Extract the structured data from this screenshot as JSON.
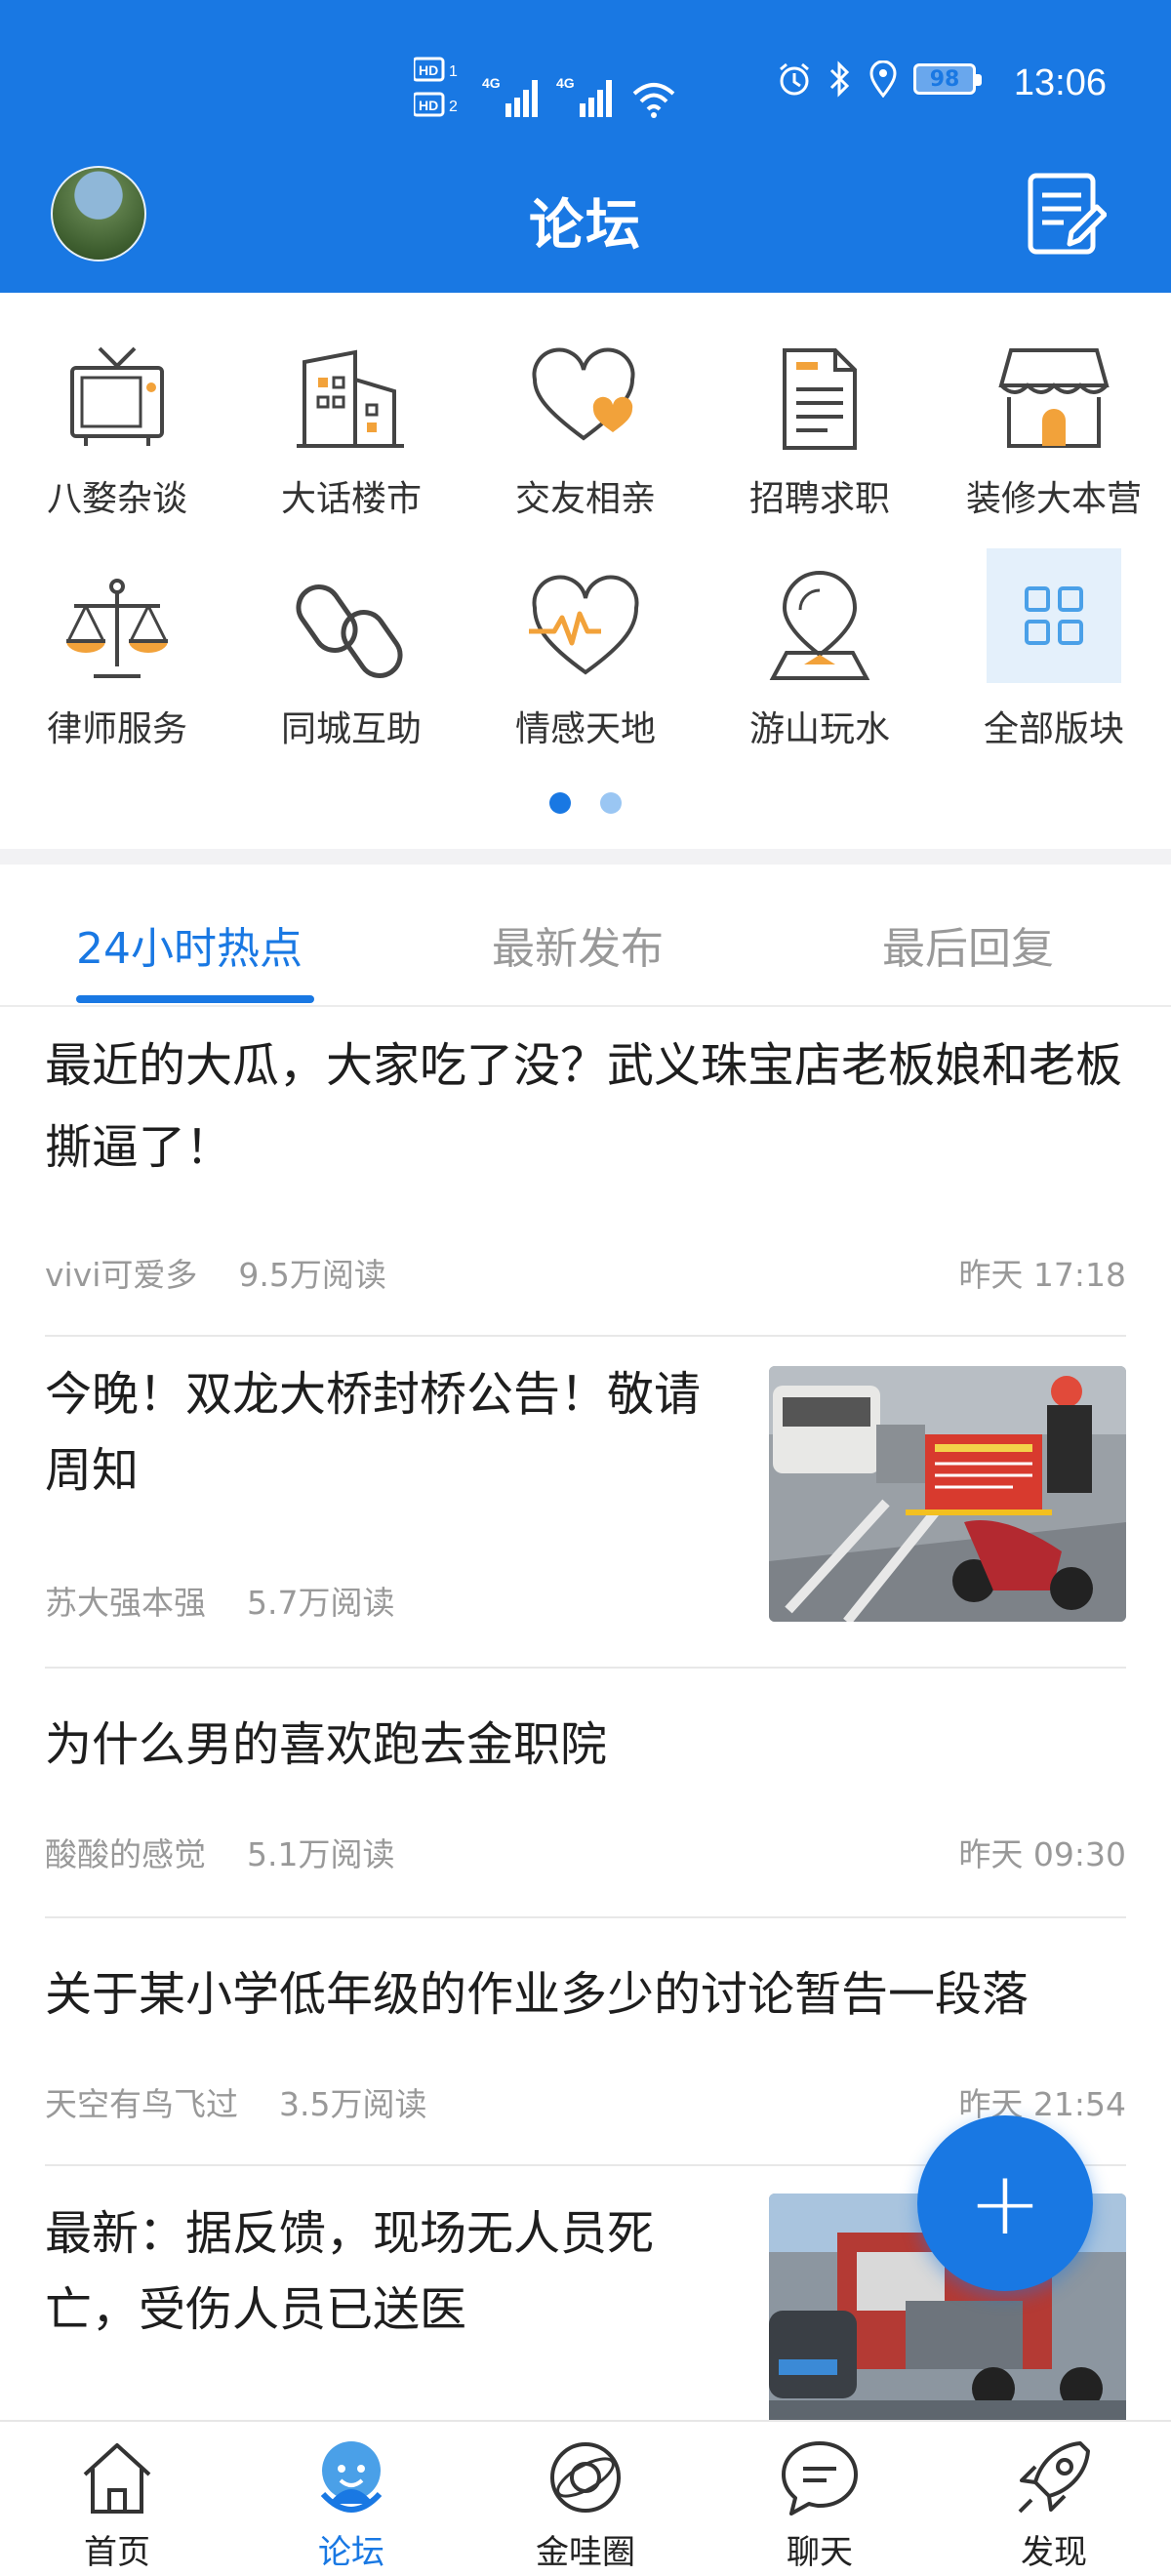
{
  "status_bar": {
    "time": "13:06",
    "battery": "98",
    "network": [
      "HD 1",
      "HD 2",
      "4G",
      "4G"
    ]
  },
  "header": {
    "title": "论坛"
  },
  "categories": [
    {
      "label": "八婺杂谈",
      "icon": "tv-icon"
    },
    {
      "label": "大话楼市",
      "icon": "buildings-icon"
    },
    {
      "label": "交友相亲",
      "icon": "hearts-icon"
    },
    {
      "label": "招聘求职",
      "icon": "document-icon"
    },
    {
      "label": "装修大本营",
      "icon": "shop-icon"
    },
    {
      "label": "律师服务",
      "icon": "scales-icon"
    },
    {
      "label": "同城互助",
      "icon": "chain-link-icon"
    },
    {
      "label": "情感天地",
      "icon": "heartbeat-icon"
    },
    {
      "label": "游山玩水",
      "icon": "location-pin-icon"
    },
    {
      "label": "全部版块",
      "icon": "grid-icon"
    }
  ],
  "pager": {
    "pages": 2,
    "current": 1
  },
  "tabs": [
    {
      "label": "24小时热点",
      "active": true
    },
    {
      "label": "最新发布",
      "active": false
    },
    {
      "label": "最后回复",
      "active": false
    }
  ],
  "posts": [
    {
      "title": "最近的大瓜，大家吃了没？武义珠宝店老板娘和老板撕逼了！",
      "author": "vivi可爱多",
      "reads": "9.5万阅读",
      "time": "昨天 17:18",
      "has_image": false
    },
    {
      "title": "今晚！双龙大桥封桥公告！敬请周知",
      "author": "苏大强本强",
      "reads": "5.7万阅读",
      "time": "",
      "has_image": true,
      "image_desc": "street-photo"
    },
    {
      "title": "为什么男的喜欢跑去金职院",
      "author": "酸酸的感觉",
      "reads": "5.1万阅读",
      "time": "昨天 09:30",
      "has_image": false
    },
    {
      "title": "关于某小学低年级的作业多少的讨论暂告一段落",
      "author": "天空有鸟飞过",
      "reads": "3.5万阅读",
      "time": "昨天 21:54",
      "has_image": false
    },
    {
      "title": "最新：据反馈，现场无人员死亡，受伤人员已送医",
      "author": "",
      "reads": "",
      "time": "",
      "has_image": true,
      "image_desc": "accident-photo"
    }
  ],
  "fab": {
    "label": "+"
  },
  "bottom_nav": [
    {
      "label": "首页",
      "icon": "home-icon",
      "active": false
    },
    {
      "label": "论坛",
      "icon": "forum-mascot-icon",
      "active": true
    },
    {
      "label": "金哇圈",
      "icon": "planet-icon",
      "active": false
    },
    {
      "label": "聊天",
      "icon": "chat-bubble-icon",
      "active": false
    },
    {
      "label": "发现",
      "icon": "rocket-icon",
      "active": false
    }
  ],
  "colors": {
    "primary": "#1978e3",
    "accent_orange": "#f2a23a",
    "muted": "#999999"
  }
}
